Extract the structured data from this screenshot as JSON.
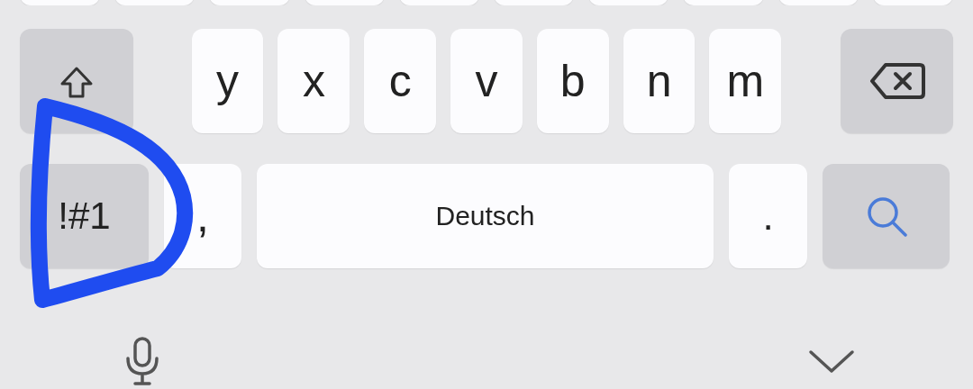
{
  "rows": [
    {
      "keys": [
        {
          "kind": "blank"
        },
        {
          "kind": "blank"
        },
        {
          "kind": "blank"
        },
        {
          "kind": "blank"
        },
        {
          "kind": "blank"
        },
        {
          "kind": "blank"
        },
        {
          "kind": "blank"
        },
        {
          "kind": "blank"
        },
        {
          "kind": "blank"
        },
        {
          "kind": "blank"
        }
      ]
    },
    {
      "keys": [
        {
          "kind": "shift"
        },
        {
          "kind": "letter",
          "label": "y"
        },
        {
          "kind": "letter",
          "label": "x"
        },
        {
          "kind": "letter",
          "label": "c"
        },
        {
          "kind": "letter",
          "label": "v"
        },
        {
          "kind": "letter",
          "label": "b"
        },
        {
          "kind": "letter",
          "label": "n"
        },
        {
          "kind": "letter",
          "label": "m"
        },
        {
          "kind": "backspace"
        }
      ]
    },
    {
      "keys": [
        {
          "kind": "symbols",
          "label": "!#1"
        },
        {
          "kind": "comma",
          "label": ","
        },
        {
          "kind": "space",
          "label": "Deutsch"
        },
        {
          "kind": "period",
          "label": "."
        },
        {
          "kind": "search"
        }
      ]
    }
  ],
  "toolbar": [
    {
      "kind": "mic"
    },
    {
      "kind": "hide"
    }
  ],
  "annotation": {
    "kind": "scribble"
  }
}
